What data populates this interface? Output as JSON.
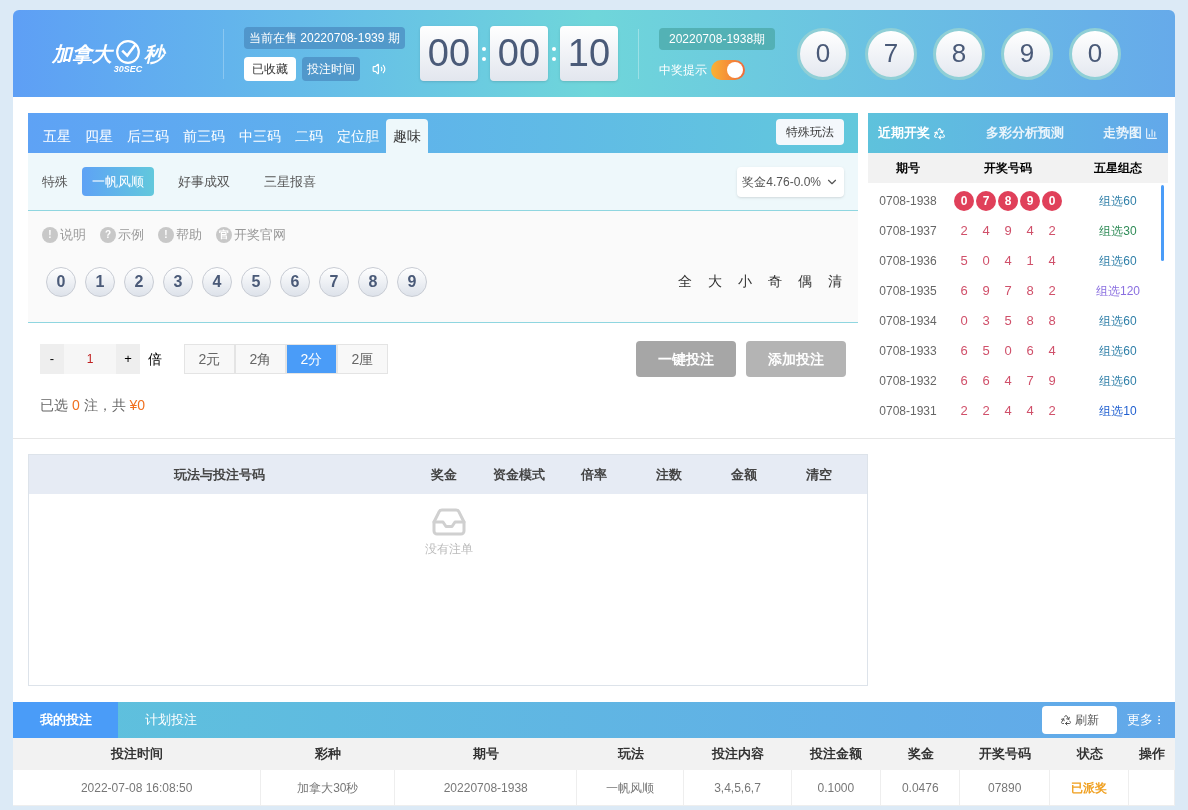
{
  "header": {
    "logo": {
      "main": "加拿大",
      "badge": "30SEC",
      "suffix": "秒"
    },
    "current_issue": "当前在售 20220708-1939 期",
    "buttons": [
      {
        "label": "已收藏",
        "kind": "light"
      },
      {
        "label": "投注时间",
        "kind": "dark"
      }
    ],
    "countdown": [
      "00",
      "00",
      "10"
    ],
    "last_issue": "20220708-1938期",
    "prize_alert": {
      "label": "中奖提示",
      "on": true
    },
    "result": [
      "0",
      "7",
      "8",
      "9",
      "0"
    ]
  },
  "play_tabs": [
    {
      "label": "五星",
      "selected": false
    },
    {
      "label": "四星",
      "selected": false
    },
    {
      "label": "后三码",
      "selected": false
    },
    {
      "label": "前三码",
      "selected": false
    },
    {
      "label": "中三码",
      "selected": false
    },
    {
      "label": "二码",
      "selected": false
    },
    {
      "label": "定位胆",
      "selected": false
    },
    {
      "label": "趣味",
      "selected": true
    }
  ],
  "special_button": "特殊玩法",
  "sub_category": "特殊",
  "sub_tabs": [
    {
      "label": "一帆风顺",
      "selected": true
    },
    {
      "label": "好事成双",
      "selected": false
    },
    {
      "label": "三星报喜",
      "selected": false
    }
  ],
  "prize_select": "奖金4.76-0.0%",
  "help_links": [
    {
      "icon": "!",
      "label": "说明"
    },
    {
      "icon": "?",
      "label": "示例"
    },
    {
      "icon": "!",
      "label": "帮助"
    },
    {
      "icon": "官",
      "label": "开奖官网"
    }
  ],
  "digits": [
    {
      "label": "0",
      "selected": false
    },
    {
      "label": "1",
      "selected": false
    },
    {
      "label": "2",
      "selected": false
    },
    {
      "label": "3",
      "selected": false
    },
    {
      "label": "4",
      "selected": false
    },
    {
      "label": "5",
      "selected": false
    },
    {
      "label": "6",
      "selected": false
    },
    {
      "label": "7",
      "selected": false
    },
    {
      "label": "8",
      "selected": false
    },
    {
      "label": "9",
      "selected": false
    }
  ],
  "quick_picks": [
    "全",
    "大",
    "小",
    "奇",
    "偶",
    "清"
  ],
  "multiplier": {
    "minus": "-",
    "value": "1",
    "plus": "+",
    "unit": "倍"
  },
  "units": [
    {
      "label": "2元",
      "selected": false
    },
    {
      "label": "2角",
      "selected": false
    },
    {
      "label": "2分",
      "selected": true
    },
    {
      "label": "2厘",
      "selected": false
    }
  ],
  "actions": [
    {
      "label": "一键投注",
      "disabled": true,
      "kind": "dark"
    },
    {
      "label": "添加投注",
      "disabled": true,
      "kind": "light"
    }
  ],
  "summary": {
    "prefix": "已选",
    "count": "0",
    "middle": "注，共",
    "amount": "¥0"
  },
  "cart": {
    "columns": [
      "玩法与投注号码",
      "奖金",
      "资金模式",
      "倍率",
      "注数",
      "金额",
      "清空"
    ],
    "empty": "没有注单"
  },
  "recent": {
    "tabs": [
      {
        "label": "近期开奖",
        "selected": true
      },
      {
        "label": "多彩分析预测",
        "selected": false
      },
      {
        "label": "走势图",
        "selected": false
      }
    ],
    "columns": [
      "期号",
      "开奖号码",
      "五星组态"
    ],
    "rows": [
      {
        "issue": "0708-1938",
        "numbers": [
          "0",
          "7",
          "8",
          "9",
          "0"
        ],
        "highlighted": true,
        "pattern": "组选60",
        "color": "#2f7fa8"
      },
      {
        "issue": "0708-1937",
        "numbers": [
          "2",
          "4",
          "9",
          "4",
          "2"
        ],
        "highlighted": false,
        "pattern": "组选30",
        "color": "#2e8b57"
      },
      {
        "issue": "0708-1936",
        "numbers": [
          "5",
          "0",
          "4",
          "1",
          "4"
        ],
        "highlighted": false,
        "pattern": "组选60",
        "color": "#2f7fa8"
      },
      {
        "issue": "0708-1935",
        "numbers": [
          "6",
          "9",
          "7",
          "8",
          "2"
        ],
        "highlighted": false,
        "pattern": "组选120",
        "color": "#8a6fe0"
      },
      {
        "issue": "0708-1934",
        "numbers": [
          "0",
          "3",
          "5",
          "8",
          "8"
        ],
        "highlighted": false,
        "pattern": "组选60",
        "color": "#2f7fa8"
      },
      {
        "issue": "0708-1933",
        "numbers": [
          "6",
          "5",
          "0",
          "6",
          "4"
        ],
        "highlighted": false,
        "pattern": "组选60",
        "color": "#2f7fa8"
      },
      {
        "issue": "0708-1932",
        "numbers": [
          "6",
          "6",
          "4",
          "7",
          "9"
        ],
        "highlighted": false,
        "pattern": "组选60",
        "color": "#2f7fa8"
      },
      {
        "issue": "0708-1931",
        "numbers": [
          "2",
          "2",
          "4",
          "4",
          "2"
        ],
        "highlighted": false,
        "pattern": "组选10",
        "color": "#1f5fd0"
      }
    ]
  },
  "bets": {
    "tabs": [
      {
        "label": "我的投注",
        "selected": true
      },
      {
        "label": "计划投注",
        "selected": false
      }
    ],
    "refresh": "刷新",
    "more": "更多",
    "columns": [
      "投注时间",
      "彩种",
      "期号",
      "玩法",
      "投注内容",
      "投注金额",
      "奖金",
      "开奖号码",
      "状态",
      "操作"
    ],
    "rows": [
      {
        "cells": [
          "2022-07-08 16:08:50",
          "加拿大30秒",
          "20220708-1938",
          "一帆风顺",
          "3,4,5,6,7",
          "0.1000",
          "0.0476",
          "07890",
          "已派奖",
          ""
        ],
        "color": "#f0a020"
      }
    ]
  }
}
